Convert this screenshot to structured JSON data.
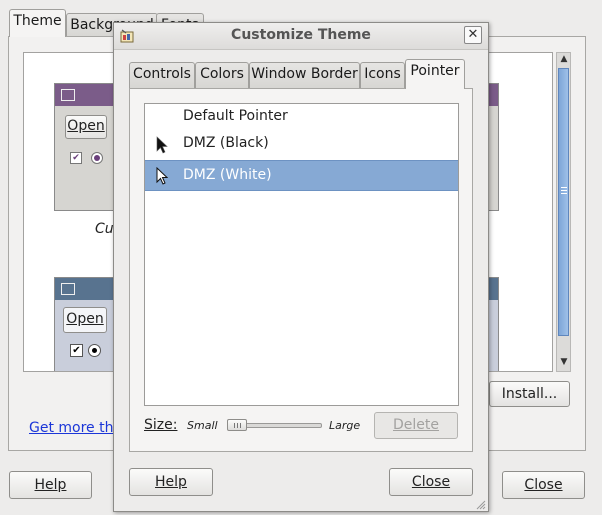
{
  "appearance": {
    "tabs": [
      {
        "label": "Theme"
      },
      {
        "label": "Background"
      },
      {
        "label": "Fonts"
      }
    ],
    "preview_open": "Open",
    "preview_caption": "Cu",
    "preview_open2": "Open",
    "get_more_link": "Get more the",
    "install_button": "Install...",
    "help_button": "Help",
    "close_button": "Close"
  },
  "dialog": {
    "title": "Customize Theme",
    "tabs": [
      {
        "label": "Controls"
      },
      {
        "label": "Colors"
      },
      {
        "label": "Window Border"
      },
      {
        "label": "Icons"
      },
      {
        "label": "Pointer"
      }
    ],
    "active_tab": "Pointer",
    "pointers": [
      {
        "label": "Default Pointer",
        "selected": false
      },
      {
        "label": "DMZ (Black)",
        "selected": false
      },
      {
        "label": "DMZ (White)",
        "selected": true
      }
    ],
    "size_label": "Size:",
    "size_small": "Small",
    "size_large": "Large",
    "size_value": 0,
    "delete_button": "Delete",
    "help_button": "Help",
    "close_button": "Close"
  },
  "colors": {
    "selection": "#86a9d4",
    "preview_titlebar_purple": "#7b5c89",
    "preview_titlebar_blue": "#58738f",
    "link": "#1b36d8"
  }
}
